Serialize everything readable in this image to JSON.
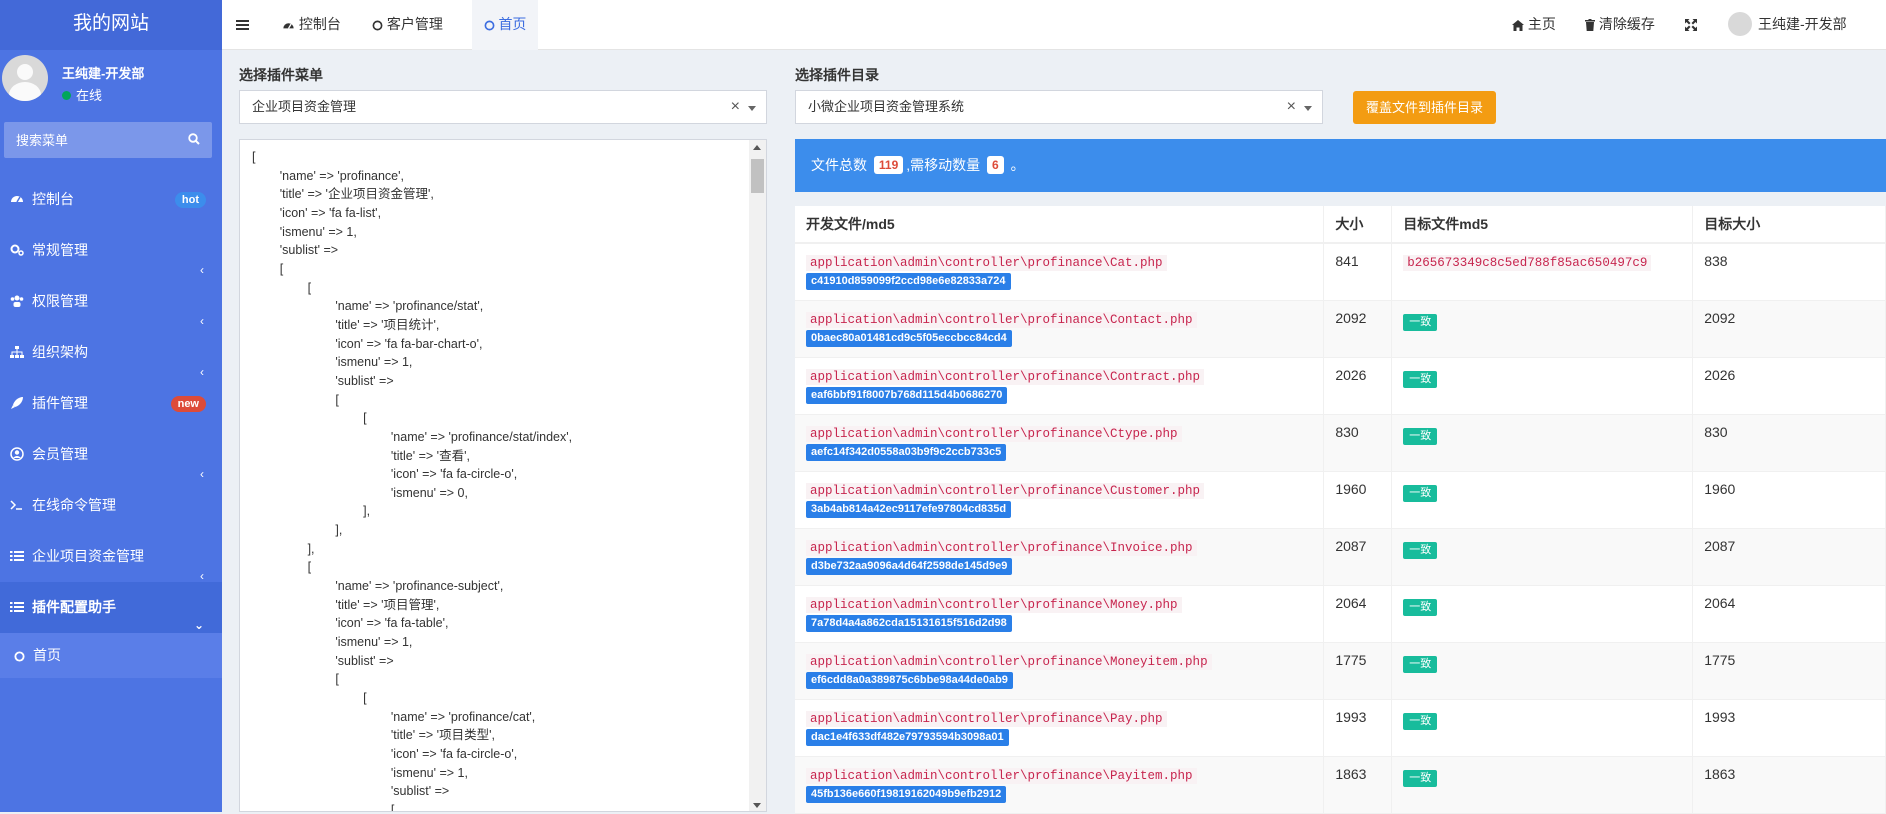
{
  "sidebar": {
    "brand": "我的网站",
    "user_name": "王纯建-开发部",
    "user_status": "在线",
    "search_placeholder": "搜索菜单",
    "items": [
      {
        "label": "控制台",
        "icon": "dashboard-icon",
        "badge": "hot",
        "badge_color": "#3c8dec"
      },
      {
        "label": "常规管理",
        "icon": "cogs-icon"
      },
      {
        "label": "权限管理",
        "icon": "group-icon"
      },
      {
        "label": "组织架构",
        "icon": "sitemap-icon"
      },
      {
        "label": "插件管理",
        "icon": "rocket-icon",
        "badge": "new",
        "badge_color": "#dd4b39"
      },
      {
        "label": "会员管理",
        "icon": "user-circle-icon"
      },
      {
        "label": "在线命令管理",
        "icon": "terminal-icon"
      },
      {
        "label": "企业项目资金管理",
        "icon": "list-icon"
      },
      {
        "label": "插件配置助手",
        "icon": "list-icon"
      }
    ],
    "sub_item": "首页"
  },
  "topbar": {
    "tabs": [
      "控制台",
      "客户管理",
      "首页"
    ],
    "home": "主页",
    "clear_cache": "清除缓存",
    "user": "王纯建-开发部"
  },
  "form": {
    "menu_label": "选择插件菜单",
    "menu_value": "企业项目资金管理",
    "dir_label": "选择插件目录",
    "dir_value": "小微企业项目资金管理系统",
    "cover_button": "覆盖文件到插件目录"
  },
  "code_text": "[\n        'name' => 'profinance',\n        'title' => '企业项目资金管理',\n        'icon' => 'fa fa-list',\n        'ismenu' => 1,\n        'sublist' =>\n        [\n                [\n                        'name' => 'profinance/stat',\n                        'title' => '项目统计',\n                        'icon' => 'fa fa-bar-chart-o',\n                        'ismenu' => 1,\n                        'sublist' =>\n                        [\n                                [\n                                        'name' => 'profinance/stat/index',\n                                        'title' => '查看',\n                                        'icon' => 'fa fa-circle-o',\n                                        'ismenu' => 0,\n                                ],\n                        ],\n                ],\n                [\n                        'name' => 'profinance-subject',\n                        'title' => '项目管理',\n                        'icon' => 'fa fa-table',\n                        'ismenu' => 1,\n                        'sublist' =>\n                        [\n                                [\n                                        'name' => 'profinance/cat',\n                                        'title' => '项目类型',\n                                        'icon' => 'fa fa-circle-o',\n                                        'ismenu' => 1,\n                                        'sublist' =>\n                                        [",
  "summary": {
    "prefix": "文件总数",
    "total": "119",
    "middle": ",需移动数量",
    "move": "6",
    "suffix": "。"
  },
  "table": {
    "headers": [
      "开发文件/md5",
      "大小",
      "目标文件md5",
      "目标大小"
    ],
    "rows": [
      {
        "path": "application\\admin\\controller\\profinance\\Cat.php",
        "md5": "c41910d859099f2ccd98e6e82833a724",
        "size": "841",
        "target_md5": "b265673349c8c5ed788f85ac650497c9",
        "target_size": "838"
      },
      {
        "path": "application\\admin\\controller\\profinance\\Contact.php",
        "md5": "0baec80a01481cd9c5f05eccbcc84cd4",
        "size": "2092",
        "status": "一致",
        "target_size": "2092"
      },
      {
        "path": "application\\admin\\controller\\profinance\\Contract.php",
        "md5": "eaf6bbf91f8007b768d115d4b0686270",
        "size": "2026",
        "status": "一致",
        "target_size": "2026"
      },
      {
        "path": "application\\admin\\controller\\profinance\\Ctype.php",
        "md5": "aefc14f342d0558a03b9f9c2ccb733c5",
        "size": "830",
        "status": "一致",
        "target_size": "830"
      },
      {
        "path": "application\\admin\\controller\\profinance\\Customer.php",
        "md5": "3ab4ab814a42ec9117efe97804cd835d",
        "size": "1960",
        "status": "一致",
        "target_size": "1960"
      },
      {
        "path": "application\\admin\\controller\\profinance\\Invoice.php",
        "md5": "d3be732aa9096a4d64f2598de145d9e9",
        "size": "2087",
        "status": "一致",
        "target_size": "2087"
      },
      {
        "path": "application\\admin\\controller\\profinance\\Money.php",
        "md5": "7a78d4a4a862cda15131615f516d2d98",
        "size": "2064",
        "status": "一致",
        "target_size": "2064"
      },
      {
        "path": "application\\admin\\controller\\profinance\\Moneyitem.php",
        "md5": "ef6cdd8a0a389875c6bbe98a44de0ab9",
        "size": "1775",
        "status": "一致",
        "target_size": "1775"
      },
      {
        "path": "application\\admin\\controller\\profinance\\Pay.php",
        "md5": "dac1e4f633df482e79793594b3098a01",
        "size": "1993",
        "status": "一致",
        "target_size": "1993"
      },
      {
        "path": "application\\admin\\controller\\profinance\\Payitem.php",
        "md5": "45fb136e660f19819162049b9efb2912",
        "size": "1863",
        "status": "一致",
        "target_size": "1863"
      }
    ]
  }
}
